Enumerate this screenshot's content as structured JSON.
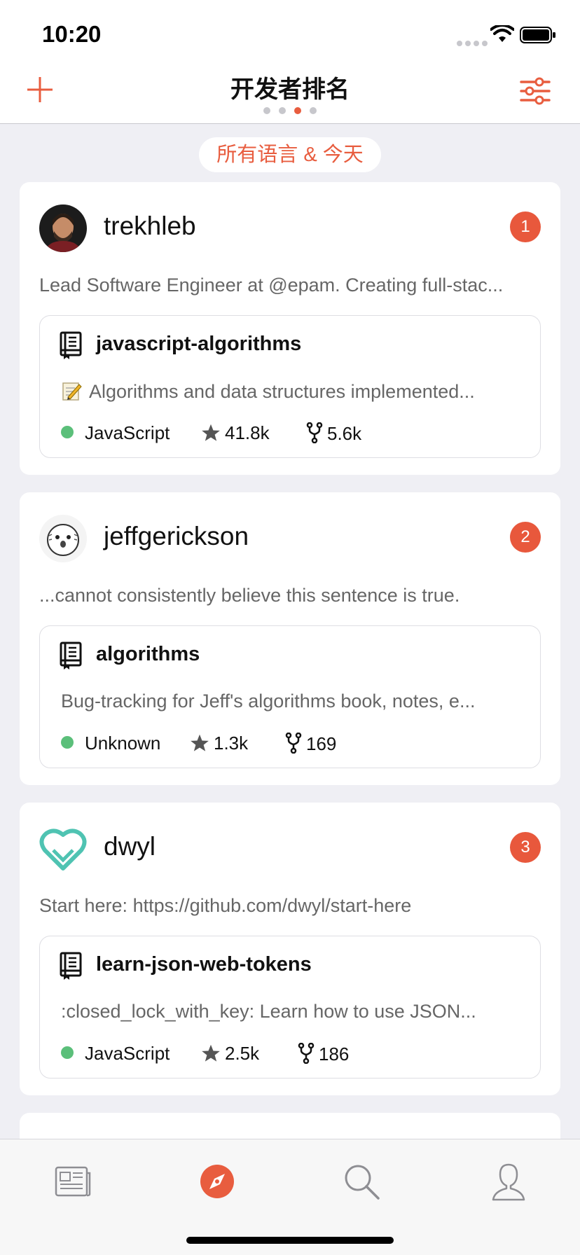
{
  "status": {
    "time": "10:20"
  },
  "nav": {
    "title": "开发者排名",
    "filter_icon": "sliders-icon",
    "add_icon": "plus-icon"
  },
  "filter_pill": "所有语言 & 今天",
  "colors": {
    "accent": "#e85d3f",
    "badge": "#e8583c",
    "language_dot": "#5bbf7a"
  },
  "developers": [
    {
      "username": "trekhleb",
      "rank": "1",
      "bio": "Lead Software Engineer at @epam. Creating full-stac...",
      "repo": {
        "name": "javascript-algorithms",
        "description": "Algorithms and data structures implemented...",
        "has_memo_emoji": true,
        "language": "JavaScript",
        "stars": "41.8k",
        "forks": "5.6k"
      }
    },
    {
      "username": "jeffgerickson",
      "rank": "2",
      "bio": "...cannot consistently believe this sentence is true.",
      "repo": {
        "name": "algorithms",
        "description": "Bug-tracking for Jeff's algorithms book, notes, e...",
        "language": "Unknown",
        "stars": "1.3k",
        "forks": "169"
      }
    },
    {
      "username": "dwyl",
      "rank": "3",
      "bio": "Start here: https://github.com/dwyl/start-here",
      "repo": {
        "name": "learn-json-web-tokens",
        "description": ":closed_lock_with_key: Learn how to use JSON...",
        "language": "JavaScript",
        "stars": "2.5k",
        "forks": "186"
      }
    }
  ],
  "tabs": [
    {
      "icon": "news-icon",
      "active": false
    },
    {
      "icon": "explore-compass-icon",
      "active": true
    },
    {
      "icon": "search-icon",
      "active": false
    },
    {
      "icon": "profile-icon",
      "active": false
    }
  ]
}
